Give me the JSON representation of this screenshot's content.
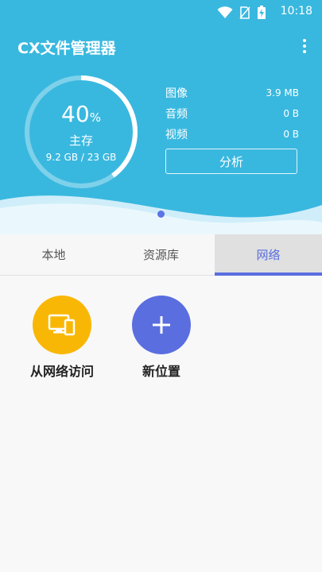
{
  "status_bar": {
    "time": "10:18"
  },
  "app": {
    "title": "CX文件管理器"
  },
  "storage": {
    "percent": "40",
    "percent_sign": "%",
    "percent_value": 0.4,
    "label": "主存",
    "size": "9.2 GB / 23 GB"
  },
  "stats": [
    {
      "label": "图像",
      "value": "3.9 MB"
    },
    {
      "label": "音频",
      "value": "0 B"
    },
    {
      "label": "视频",
      "value": "0 B"
    }
  ],
  "analyze_label": "分析",
  "tabs": [
    {
      "label": "本地"
    },
    {
      "label": "资源库"
    },
    {
      "label": "网络"
    }
  ],
  "locations": [
    {
      "label": "从网络访问",
      "icon": "devices-icon",
      "color": "#f9b705"
    },
    {
      "label": "新位置",
      "icon": "plus-icon",
      "color": "#5a6ee0"
    }
  ],
  "colors": {
    "header": "#39b8df",
    "accent": "#5a6ee0"
  }
}
